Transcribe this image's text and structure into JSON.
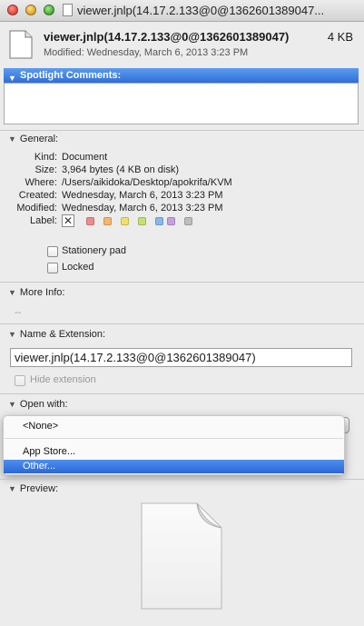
{
  "titlebar": {
    "title": "viewer.jnlp(14.17.2.133@0@1362601389047...",
    "controls": [
      "close",
      "minimize",
      "zoom"
    ]
  },
  "header": {
    "filename": "viewer.jnlp(14.17.2.133@0@1362601389047)",
    "size": "4 KB",
    "modified": "Modified: Wednesday, March 6, 2013 3:23 PM"
  },
  "spotlight": {
    "heading": "Spotlight Comments:",
    "value": ""
  },
  "general": {
    "heading": "General:",
    "kind_label": "Kind:",
    "kind": "Document",
    "size_label": "Size:",
    "size": "3,964 bytes (4 KB on disk)",
    "where_label": "Where:",
    "where": "/Users/aikidoka/Desktop/apokrifa/KVM",
    "created_label": "Created:",
    "created": "Wednesday, March 6, 2013 3:23 PM",
    "modified_label": "Modified:",
    "modified": "Wednesday, March 6, 2013 3:23 PM",
    "label_label": "Label:",
    "label_colors": [
      "#f08a8a",
      "#f5b86a",
      "#f0e070",
      "#c6e070",
      "#88b8f0",
      "#c8a0e0",
      "#bdbdbd"
    ],
    "stationery_label": "Stationery pad",
    "locked_label": "Locked"
  },
  "more_info": {
    "heading": "More Info:",
    "value": "--"
  },
  "name_extension": {
    "heading": "Name & Extension:",
    "name_value": "viewer.jnlp(14.17.2.133@0@1362601389047)",
    "hide_extension_label": "Hide extension"
  },
  "open_with": {
    "heading": "Open with:",
    "menu_items": [
      "<None>",
      "App Store...",
      "Other..."
    ],
    "highlighted": "Other..."
  },
  "preview": {
    "heading": "Preview:"
  },
  "colors": {
    "accent": "#2f6fd9",
    "window_bg": "#ececec"
  }
}
